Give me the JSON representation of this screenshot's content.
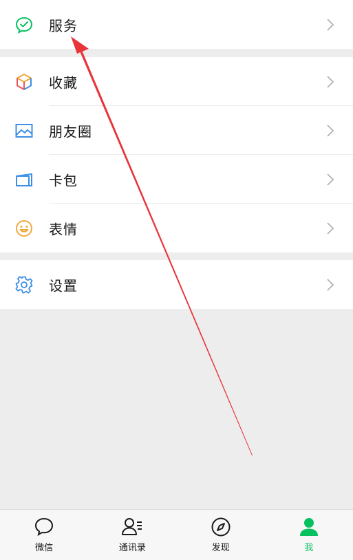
{
  "menu": {
    "services": {
      "label": "服务",
      "icon": "service-icon"
    },
    "favorites": {
      "label": "收藏",
      "icon": "cube-icon"
    },
    "moments": {
      "label": "朋友圈",
      "icon": "picture-icon"
    },
    "cards": {
      "label": "卡包",
      "icon": "card-icon"
    },
    "stickers": {
      "label": "表情",
      "icon": "smiley-icon"
    },
    "settings": {
      "label": "设置",
      "icon": "gear-icon"
    }
  },
  "tabbar": {
    "tabs": [
      {
        "label": "微信",
        "icon": "chat-bubble-icon",
        "active": false
      },
      {
        "label": "通讯录",
        "icon": "contacts-icon",
        "active": false
      },
      {
        "label": "发现",
        "icon": "compass-icon",
        "active": false
      },
      {
        "label": "我",
        "icon": "person-icon",
        "active": true
      }
    ]
  },
  "colors": {
    "accent": "#07c160",
    "background": "#ededed",
    "annotation_arrow": "#e8353a"
  }
}
